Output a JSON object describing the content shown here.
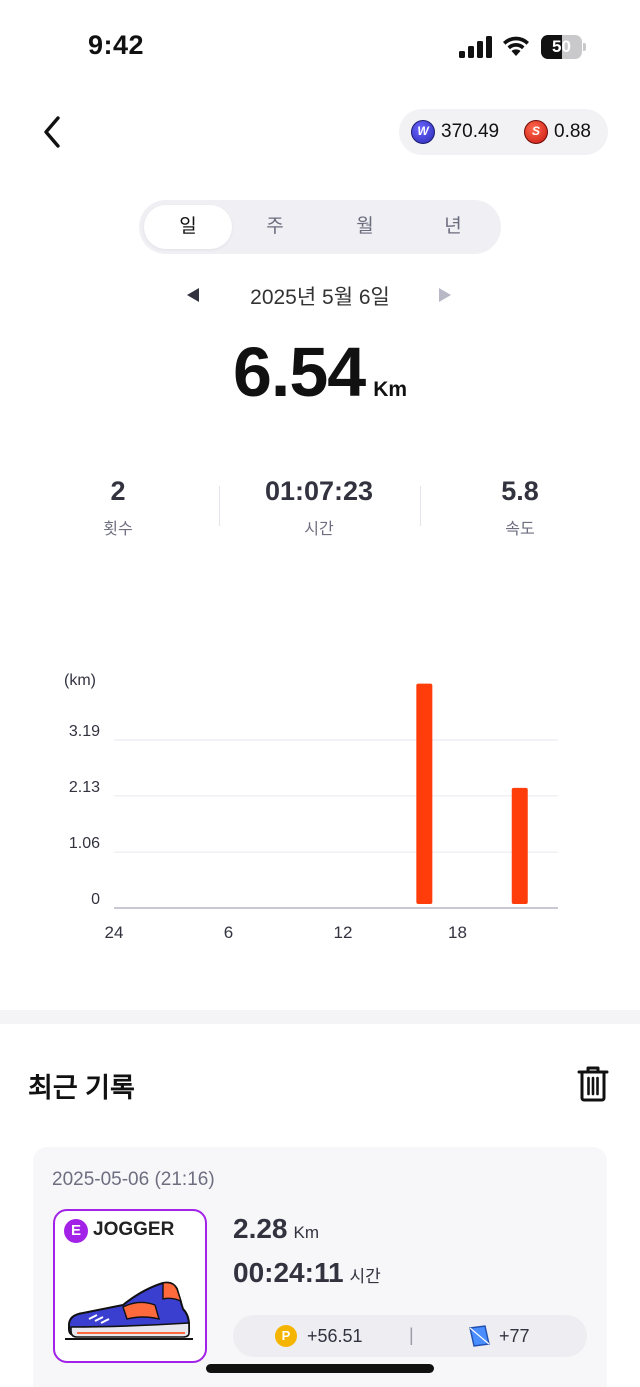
{
  "status_bar": {
    "time": "9:42",
    "battery": "50",
    "battery_level": 0.5
  },
  "header": {
    "balance_w_icon": "w-coin-icon",
    "balance_w": "370.49",
    "balance_s_icon": "s-coin-icon",
    "balance_s": "0.88"
  },
  "tabs": [
    {
      "label": "일",
      "active": true
    },
    {
      "label": "주",
      "active": false
    },
    {
      "label": "월",
      "active": false
    },
    {
      "label": "년",
      "active": false
    }
  ],
  "date": "2025년 5월 6일",
  "distance": {
    "value": "6.54",
    "unit": "Km"
  },
  "stats": [
    {
      "value": "2",
      "label": "횟수"
    },
    {
      "value": "01:07:23",
      "label": "시간"
    },
    {
      "value": "5.8",
      "label": "속도"
    }
  ],
  "chart_data": {
    "type": "bar",
    "ylabel": "(km)",
    "y_ticks": [
      "0",
      "1.06",
      "2.13",
      "3.19"
    ],
    "ylim": [
      0,
      3.19
    ],
    "x_ticks": [
      "24",
      "6",
      "12",
      "18"
    ],
    "x_tick_hours": [
      0,
      6,
      12,
      18
    ],
    "xlim": [
      0,
      24
    ],
    "bars": [
      {
        "hour": 16,
        "value": 4.26
      },
      {
        "hour": 21,
        "value": 2.28
      }
    ],
    "bar_color": "#ff3d0a",
    "grid": true
  },
  "recent": {
    "title": "최근 기록",
    "delete_icon": "trash-icon",
    "records": [
      {
        "datetime": "2025-05-06 (21:16)",
        "grade": "E",
        "shoe": "JOGGER",
        "distance": "2.28",
        "distance_unit": "Km",
        "duration": "00:24:11",
        "duration_unit": "시간",
        "reward_points": "+56.51",
        "reward_map": "+77"
      }
    ]
  },
  "colors": {
    "accent": "#ff3d0a",
    "grade": "#a322e8",
    "points": "#f5b400"
  }
}
